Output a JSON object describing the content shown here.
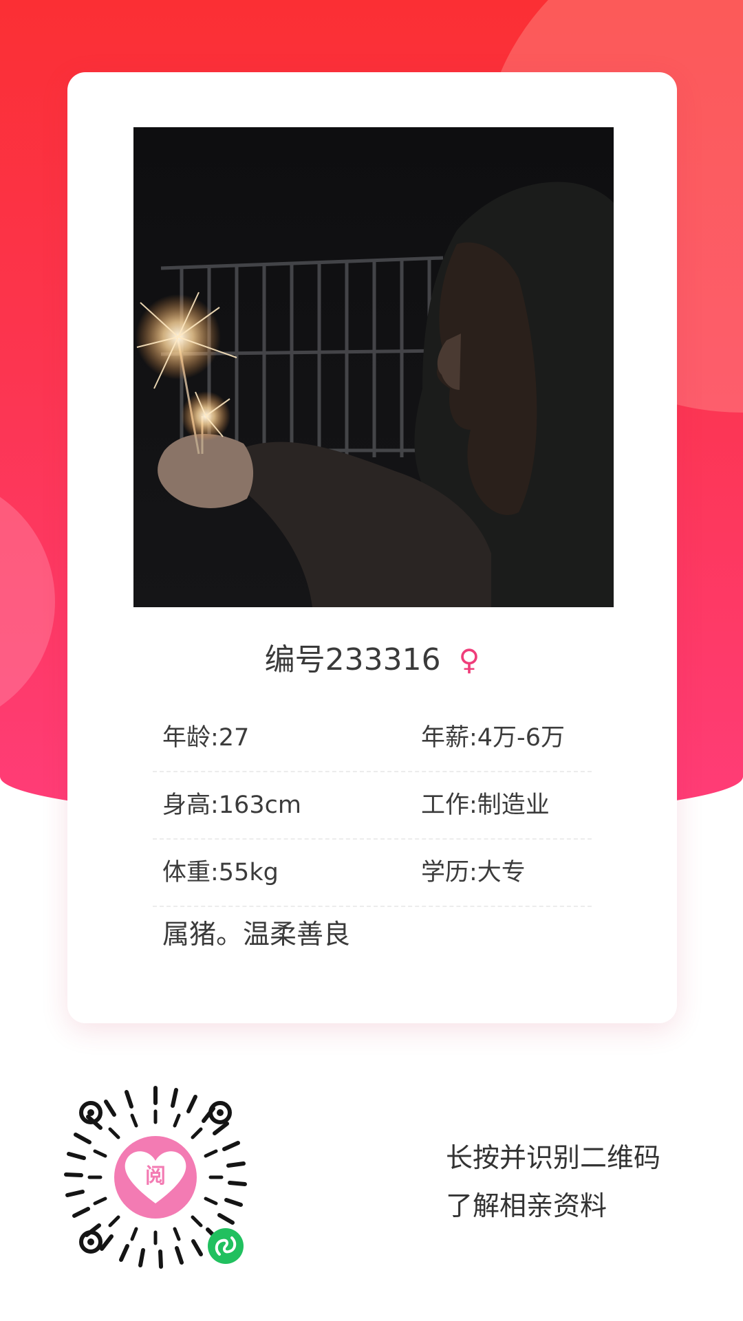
{
  "profile": {
    "title": "编号233316",
    "gender_symbol": "♀",
    "fields": [
      {
        "left": "年龄:27",
        "right": "年薪:4万-6万"
      },
      {
        "left": "身高:163cm",
        "right": "工作:制造业"
      },
      {
        "left": "体重:55kg",
        "right": "学历:大专"
      }
    ],
    "bio": "属猪。温柔善良"
  },
  "qr_section": {
    "logo_char": "阅",
    "line1": "长按并识别二维码",
    "line2": "了解相亲资料"
  },
  "colors": {
    "brand_red": "#fb2f34",
    "brand_pink": "#ff3d78",
    "gender_pink": "#ef3d7a",
    "qr_logo_pink": "#f37bb3",
    "wechat_green": "#21c05f"
  }
}
